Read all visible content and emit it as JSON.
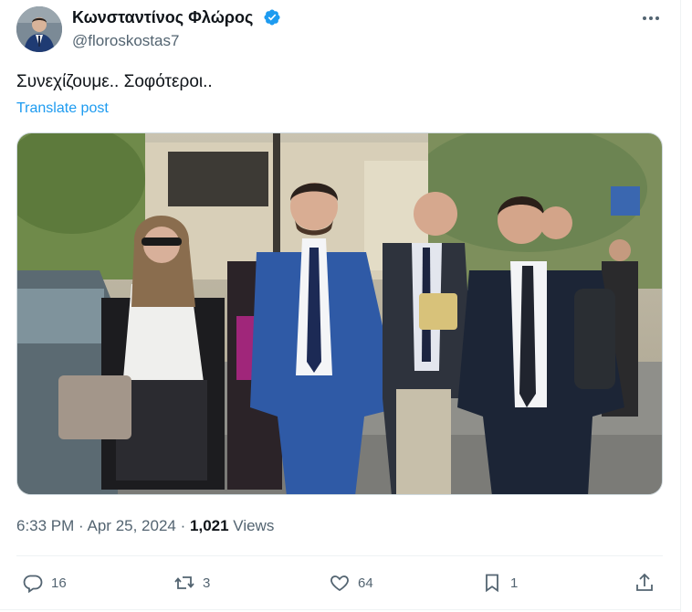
{
  "author": {
    "name": "Κωνσταντίνος Φλώρος",
    "handle": "@floroskostas7"
  },
  "post": {
    "text": "Συνεχίζουμε.. Σοφότεροι..",
    "translate_label": "Translate post",
    "time": "6:33 PM",
    "date": "Apr 25, 2024",
    "separator": "·",
    "views_count": "1,021",
    "views_label": "Views"
  },
  "actions": {
    "replies": "16",
    "reposts": "3",
    "likes": "64",
    "bookmarks": "1"
  },
  "colors": {
    "accent": "#1d9bf0",
    "secondary_text": "#536471",
    "primary_text": "#0f1419"
  },
  "icons": [
    "verified-badge-icon",
    "more-icon",
    "reply-icon",
    "repost-icon",
    "like-icon",
    "bookmark-icon",
    "share-icon"
  ]
}
